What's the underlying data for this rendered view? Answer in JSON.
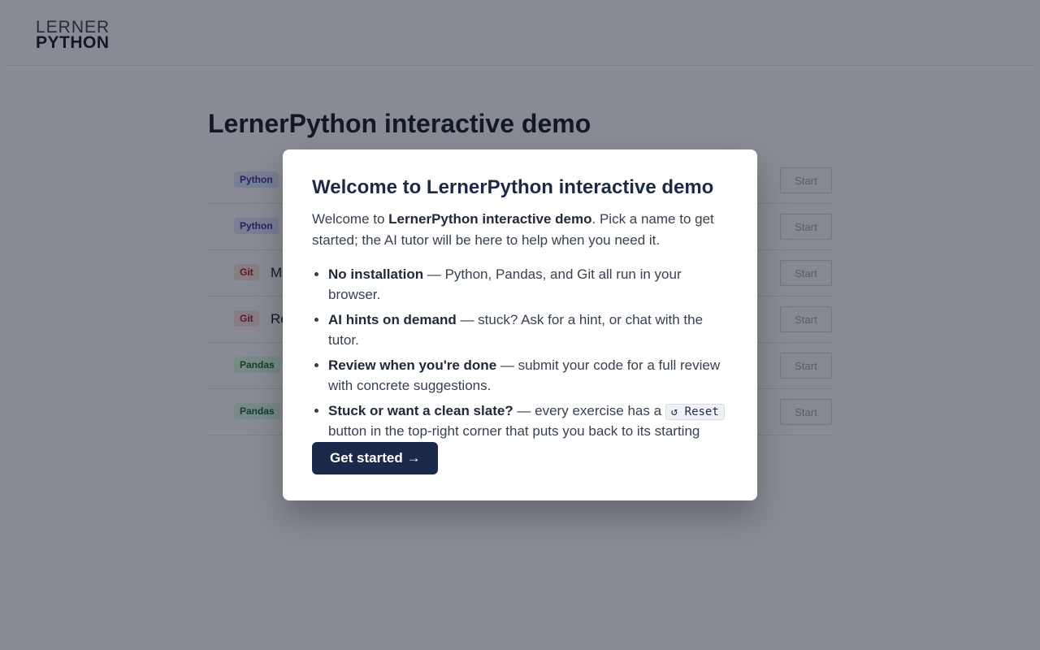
{
  "logo": {
    "line1": "LERNER",
    "line2": "PYTHON"
  },
  "page_title": "LernerPython interactive demo",
  "exercises": [
    {
      "tag": "Python",
      "title": "",
      "start_label": "Start"
    },
    {
      "tag": "Python",
      "title": "",
      "start_label": "Start"
    },
    {
      "tag": "Git",
      "title": "M",
      "start_label": "Start"
    },
    {
      "tag": "Git",
      "title": "Re",
      "start_label": "Start"
    },
    {
      "tag": "Pandas",
      "title": "",
      "start_label": "Start"
    },
    {
      "tag": "Pandas",
      "title": "",
      "start_label": "Start"
    }
  ],
  "modal": {
    "title": "Welcome to LernerPython interactive demo",
    "intro_prefix": "Welcome to ",
    "intro_bold": "LernerPython interactive demo",
    "intro_suffix": ". Pick a name to get started; the AI tutor will be here to help when you need it.",
    "features": [
      {
        "bold": "No installation",
        "text": " — Python, Pandas, and Git all run in your browser."
      },
      {
        "bold": "AI hints on demand",
        "text": " — stuck? Ask for a hint, or chat with the tutor."
      },
      {
        "bold": "Review when you're done",
        "text": " — submit your code for a full review with concrete suggestions."
      },
      {
        "bold": "Stuck or want a clean slate?",
        "text_before": " — every exercise has a ",
        "chip": "↺ Reset",
        "text_after": " button in the top-right corner that puts you back to its starting state."
      }
    ],
    "cta_label": "Get started →"
  },
  "colors": {
    "accent": "#1b2a4a",
    "overlay": "rgba(17,24,39,0.5)"
  }
}
